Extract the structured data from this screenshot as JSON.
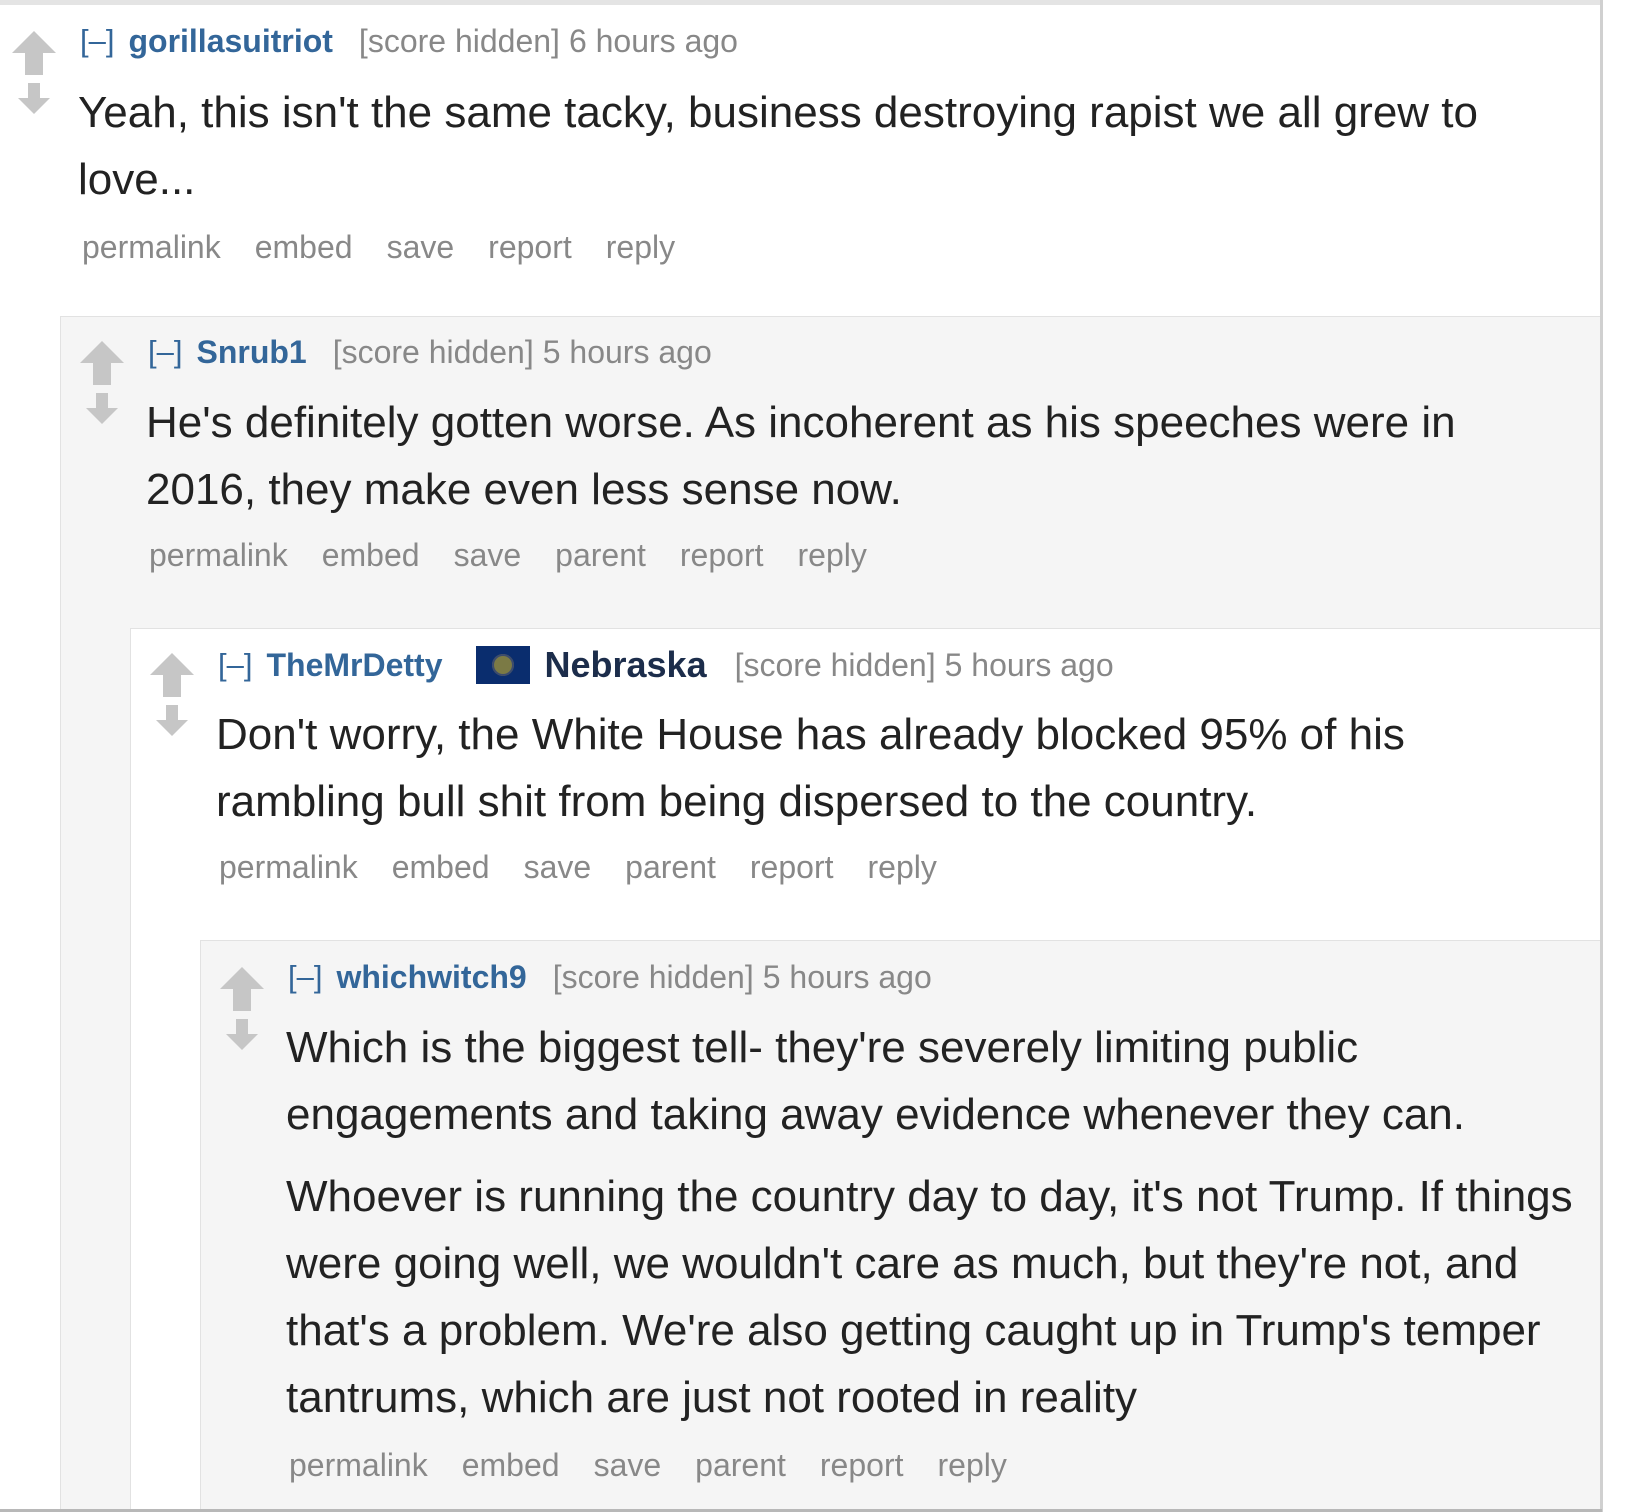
{
  "ui": {
    "expand_label": "[–]",
    "score_label": "[score hidden]",
    "upvote_icon": "upvote-arrow-icon",
    "downvote_icon": "downvote-arrow-icon",
    "colors": {
      "author": "#336699",
      "meta": "#888888",
      "text": "#222222",
      "alt_background": "#f5f5f5"
    }
  },
  "comments": [
    {
      "author": "gorillasuitriot",
      "time": "6 hours ago",
      "paragraphs": [
        "Yeah, this isn't the same tacky, business destroying rapist we all grew to love..."
      ],
      "buttons": [
        "permalink",
        "embed",
        "save",
        "report",
        "reply"
      ]
    },
    {
      "author": "Snrub1",
      "time": "5 hours ago",
      "paragraphs": [
        "He's definitely gotten worse. As incoherent as his speeches were in 2016, they make even less sense now."
      ],
      "buttons": [
        "permalink",
        "embed",
        "save",
        "parent",
        "report",
        "reply"
      ]
    },
    {
      "author": "TheMrDetty",
      "flair": {
        "icon": "nebraska-flag-icon",
        "text": "Nebraska"
      },
      "time": "5 hours ago",
      "paragraphs": [
        "Don't worry, the White House has already blocked 95% of his rambling bull shit from being dispersed to the country."
      ],
      "buttons": [
        "permalink",
        "embed",
        "save",
        "parent",
        "report",
        "reply"
      ]
    },
    {
      "author": "whichwitch9",
      "time": "5 hours ago",
      "paragraphs": [
        "Which is the biggest tell- they're severely limiting public engagements and taking away evidence whenever they can.",
        "Whoever is running the country day to day, it's not Trump. If things were going well, we wouldn't care as much, but they're not, and that's a problem. We're also getting caught up in Trump's temper tantrums, which are just not rooted in reality"
      ],
      "buttons": [
        "permalink",
        "embed",
        "save",
        "parent",
        "report",
        "reply"
      ]
    }
  ]
}
